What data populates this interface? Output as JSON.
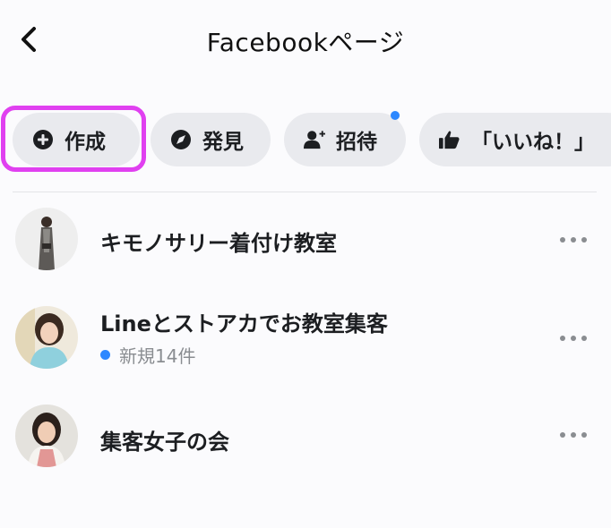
{
  "header": {
    "title": "Facebookページ",
    "back_icon": "chevron-left-icon"
  },
  "chips": [
    {
      "label": "作成",
      "icon": "plus-circle-icon",
      "highlighted": true
    },
    {
      "label": "発見",
      "icon": "compass-icon"
    },
    {
      "label": "招待",
      "icon": "add-person-icon",
      "has_notification_dot": true
    },
    {
      "label": "「いいね！」",
      "icon": "thumbs-up-icon"
    }
  ],
  "pages": [
    {
      "name": "キモノサリー着付け教室",
      "avatar": "person-in-kimono-photo"
    },
    {
      "name": "Lineとストアカでお教室集客",
      "subtitle": "新規14件",
      "subtitle_dot_color": "#2d88ff",
      "avatar": "woman-portrait-photo"
    },
    {
      "name": "集客女子の会",
      "avatar": "woman-portrait-photo"
    }
  ],
  "colors": {
    "highlight": "#e040f0",
    "accent": "#2d88ff",
    "chip_bg": "#e9eaee"
  }
}
